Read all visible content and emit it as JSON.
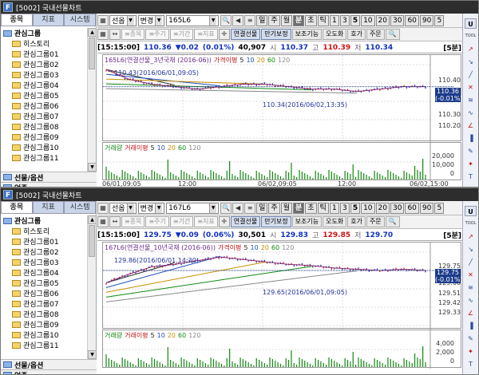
{
  "windows": [
    {
      "title": "[5002] 국내선물차트",
      "tabs": [
        "종목",
        "지표",
        "시스템"
      ],
      "tree": {
        "root": "관심그룹",
        "children": [
          "히스토리",
          "관심그룹01",
          "관심그룹02",
          "관심그룹03",
          "관심그룹04",
          "관심그룹05",
          "관심그룹06",
          "관심그룹07",
          "관심그룹08",
          "관심그룹09",
          "관심그룹10",
          "관심그룹11"
        ],
        "bottom": [
          "선물/옵션",
          "업종"
        ]
      },
      "toolbar": {
        "market": "선옵",
        "change": "변경",
        "code": "165L6",
        "periods": [
          "일",
          "주",
          "월",
          "분",
          "초",
          "틱"
        ],
        "active_period": "분",
        "intervals": [
          "1",
          "3",
          "5",
          "10",
          "20",
          "30",
          "60",
          "90",
          "5"
        ],
        "active_interval": "5",
        "row2_dim": [
          "≡종목",
          "≡주기",
          "≡기간",
          "≡지표"
        ],
        "row2_btns": [
          "연결선물",
          "만기보정",
          "보조기능",
          "오도화",
          "호가",
          "주문",
          "🔍"
        ]
      },
      "info": {
        "time": "[15:15:00]",
        "price": "110.36",
        "change": "▼0.02",
        "rate": "(0.01%)",
        "volume": "40,907",
        "open_label": "시",
        "open": "110.37",
        "high_label": "고",
        "high": "110.39",
        "low_label": "저",
        "low": "110.34",
        "interval": "[5분]"
      },
      "legend": {
        "series": "165L6(연결선물_3년국채 (2016-06))",
        "ma_label": "가격이평",
        "ma": [
          "5",
          "10",
          "20",
          "60",
          "120"
        ]
      },
      "annotations": {
        "high_note": "110.43(2016/06/01,09:05)",
        "low_note": "110.34(2016/06/02,13:35)"
      },
      "yaxis": [
        "110.40",
        "110.30",
        "110.20"
      ],
      "last": {
        "price": "110.36",
        "rate": "(-0.01%)"
      },
      "volume_legend": {
        "label": "거래량",
        "ma_label": "거래이평",
        "ma": [
          "5",
          "10",
          "20",
          "60",
          "120"
        ]
      },
      "volume_axis": [
        "20,000",
        "10,000",
        "0"
      ],
      "xaxis": [
        "06/01,09:05",
        "12:00",
        "06/02,09:05",
        "12:00",
        "06/02,15:00"
      ],
      "chart_data": {
        "type": "line",
        "title": "165L6(연결선물_3년국채 (2016-06))",
        "series": [
          {
            "name": "165L6",
            "values": [
              110.43,
              110.39,
              110.37,
              110.36,
              110.35,
              110.36,
              110.37,
              110.37,
              110.36,
              110.35,
              110.35,
              110.34,
              110.35,
              110.36,
              110.36
            ]
          }
        ],
        "ylim": [
          110.15,
          110.45
        ],
        "grid": true
      }
    },
    {
      "title": "[5002] 국내선물차트",
      "tabs": [
        "종목",
        "지표",
        "시스템"
      ],
      "tree": {
        "root": "관심그룹",
        "children": [
          "히스토리",
          "관심그룹01",
          "관심그룹02",
          "관심그룹03",
          "관심그룹04",
          "관심그룹05",
          "관심그룹06",
          "관심그룹07",
          "관심그룹08",
          "관심그룹09",
          "관심그룹10",
          "관심그룹11"
        ],
        "bottom": [
          "선물/옵션",
          "업종"
        ]
      },
      "toolbar": {
        "market": "선옵",
        "change": "변경",
        "code": "167L6",
        "periods": [
          "일",
          "주",
          "월",
          "분",
          "초",
          "틱"
        ],
        "active_period": "분",
        "intervals": [
          "1",
          "3",
          "5",
          "10",
          "20",
          "30",
          "60",
          "90",
          "5"
        ],
        "active_interval": "5",
        "row2_dim": [
          "≡종목",
          "≡주기",
          "≡기간",
          "≡지표"
        ],
        "row2_btns": [
          "연결선물",
          "만기보정",
          "보조기능",
          "오도화",
          "호가",
          "주문",
          "🔍"
        ]
      },
      "info": {
        "time": "[15:15:00]",
        "price": "129.75",
        "change": "▼0.09",
        "rate": "(0.06%)",
        "volume": "30,501",
        "open_label": "시",
        "open": "129.83",
        "high_label": "고",
        "high": "129.85",
        "low_label": "저",
        "low": "129.70",
        "interval": "[5분]"
      },
      "legend": {
        "series": "167L6(연결선물_10년국채 (2016-06))",
        "ma_label": "가격이평",
        "ma": [
          "5",
          "10",
          "20",
          "60",
          "120"
        ]
      },
      "annotations": {
        "high_note": "129.86(2016/06/01,14:30)",
        "low_note": "129.65(2016/06/01,09:05)"
      },
      "yaxis": [
        "129.75",
        "129.60",
        "129.51",
        "129.42",
        "129.33"
      ],
      "last": {
        "price": "129.75",
        "rate": "(-0.01%)"
      },
      "volume_legend": {
        "label": "거래량",
        "ma_label": "거래이평",
        "ma": [
          "5",
          "10",
          "20",
          "60",
          "120"
        ]
      },
      "volume_axis": [
        "4,000",
        "2,000",
        "0"
      ],
      "xaxis": [],
      "chart_data": {
        "type": "line",
        "title": "167L6(연결선물_10년국채 (2016-06))",
        "series": [
          {
            "name": "167L6",
            "values": [
              129.65,
              129.72,
              129.78,
              129.8,
              129.83,
              129.86,
              129.84,
              129.82,
              129.8,
              129.79,
              129.77,
              129.76,
              129.75,
              129.76,
              129.75
            ]
          }
        ],
        "ylim": [
          129.3,
          129.9
        ],
        "grid": true
      }
    }
  ],
  "sidebar_icons": [
    "U",
    "TOOL",
    "up-arrow",
    "down-arrow",
    "line-tool",
    "cross-tool",
    "fib-tool",
    "wave-tool",
    "angle-tool",
    "bar-tool",
    "pen-tool",
    "star-tool",
    "text-tool"
  ],
  "colors": {
    "up": "#d01010",
    "down": "#1030c0",
    "bg": "#ffffff",
    "titlebar": "#2d2d2d"
  }
}
